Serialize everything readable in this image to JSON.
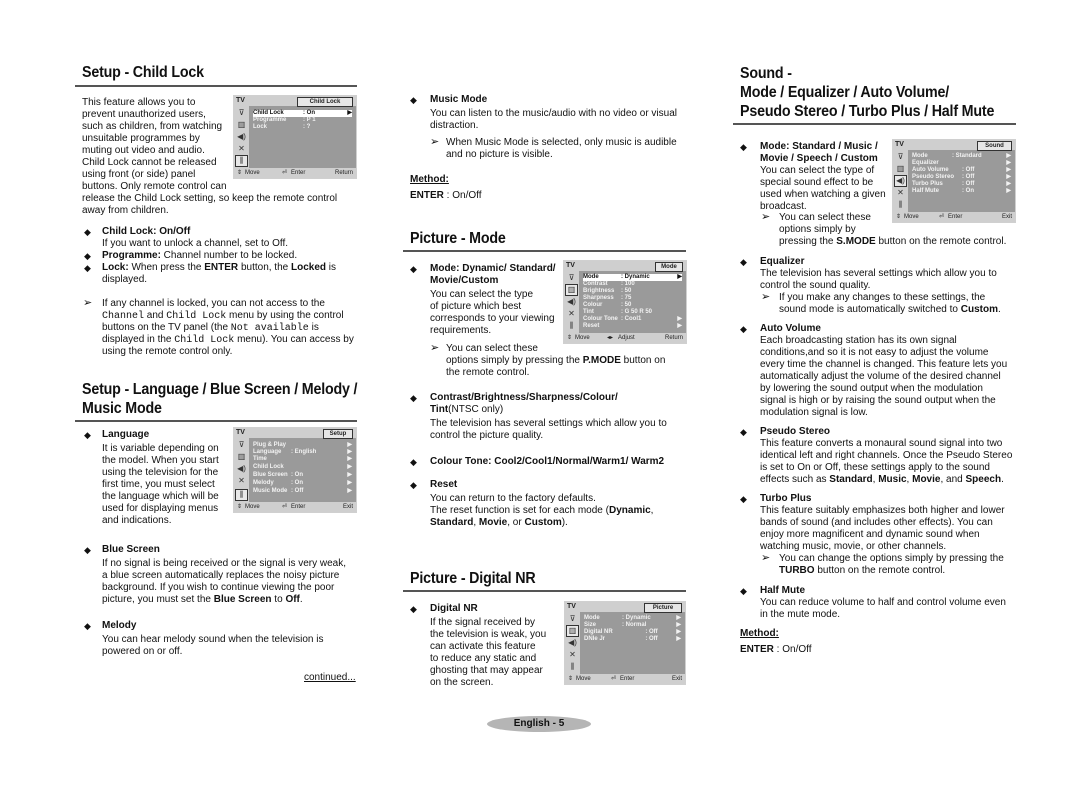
{
  "left": {
    "title1": "Setup - Child Lock",
    "intro": "This feature allows you to prevent unauthorized users, such as children, from watching unsuitable programmes by muting out video and audio. Child Lock cannot be released using front (or side) panel buttons. Only remote control can release the Child Lock setting, so keep the remote control away from children.",
    "intro_lines": [
      "This feature allows you to",
      "prevent unauthorized users,",
      "such as children, from watching",
      "unsuitable programmes by",
      "muting out video and audio.",
      "Child Lock cannot be released",
      "using front (or side) panel",
      "buttons. Only remote control can",
      "release the Child Lock setting, so keep the remote control",
      "away from children."
    ],
    "childlock_osd": {
      "tv": "TV",
      "tab": "Child Lock",
      "rows": [
        {
          "label": "Child Lock",
          "value": ": On",
          "arrow": "▶"
        },
        {
          "label": "Programme",
          "value": ": P 1",
          "arrow": ""
        },
        {
          "label": "Lock",
          "value": ": ?",
          "arrow": ""
        }
      ],
      "footer": {
        "move": "Move",
        "enter": "Enter",
        "exit": "Return"
      }
    },
    "b1_head": "Child Lock: On/Off",
    "b1_text": "If you want to unlock a channel, set to Off.",
    "b2_head": "Programme:",
    "b2_text": " Channel number to be locked.",
    "b3_head": "Lock:",
    "b3_t1": " When press the ",
    "b3_enter": "ENTER",
    "b3_t2": " button, the ",
    "b3_locked": "Locked",
    "b3_t3": " is",
    "b3_t4": "displayed.",
    "note1": "If any channel is locked, you can not access to the",
    "note2a": "Channel",
    "note2b": " and ",
    "note2c": "Child Lock",
    "note2d": " menu by using the control",
    "note3a": "buttons on the TV panel (the ",
    "note3b": "Not available",
    "note3c": " is",
    "note4a": "displayed in the ",
    "note4b": "Child Lock",
    "note4c": " menu). You can access by",
    "note5": "using the remote control only.",
    "title2_l1": "Setup - Language / Blue Screen / Melody /",
    "title2_l2": "Music Mode",
    "lang_head": "Language",
    "lang_lines": [
      "It is variable depending on",
      "the model. When you start",
      "using the television for the",
      "first time, you must select",
      "the language which will be",
      "used for displaying menus",
      "and indications."
    ],
    "setup_osd": {
      "tv": "TV",
      "tab": "Setup",
      "rows": [
        {
          "label": "Plug & Play",
          "value": "",
          "arrow": "▶"
        },
        {
          "label": "Language",
          "value": ": English",
          "arrow": "▶"
        },
        {
          "label": "Time",
          "value": "",
          "arrow": "▶"
        },
        {
          "label": "Child Lock",
          "value": "",
          "arrow": "▶"
        },
        {
          "label": "Blue Screen",
          "value": ": On",
          "arrow": "▶"
        },
        {
          "label": "Melody",
          "value": ": On",
          "arrow": "▶"
        },
        {
          "label": "Music Mode",
          "value": ": Off",
          "arrow": "▶"
        }
      ],
      "footer": {
        "move": "Move",
        "enter": "Enter",
        "exit": "Exit"
      }
    },
    "blue_head": "Blue Screen",
    "blue_lines": [
      "If no signal is being received or the signal is very weak,",
      "a blue screen automatically replaces the noisy picture",
      "background. If you wish to continue viewing the poor"
    ],
    "blue_l4a": "picture, you must set the ",
    "blue_l4b": "Blue Screen",
    "blue_l4c": " to ",
    "blue_l4d": "Off",
    "blue_l4e": ".",
    "melody_head": "Melody",
    "melody_lines": [
      "You can hear melody sound when the television is",
      "powered on or off."
    ],
    "continued": "continued..."
  },
  "middle": {
    "music_head": "Music Mode",
    "music_lines": [
      "You can listen to the music/audio with no video or visual",
      "distraction."
    ],
    "music_note": [
      "When Music Mode is selected, only music is audible",
      "and no picture is visible."
    ],
    "method_label": "Method:",
    "method_enter": "ENTER",
    "method_value": " : On/Off",
    "title_picture_mode": "Picture - Mode",
    "mode_head_l1": "Mode: Dynamic/ Standard/",
    "mode_head_l2": "Movie/Custom",
    "mode_lines": [
      "You can select the type",
      "of picture which best",
      "corresponds to your viewing",
      "requirements."
    ],
    "mode_note_l1": "You can select these",
    "mode_note_l2a": "options simply by pressing the ",
    "mode_note_l2b": "P.MODE",
    "mode_note_l2c": " button on",
    "mode_note_l3": "the remote control.",
    "mode_osd": {
      "tv": "TV",
      "tab": "Mode",
      "rows": [
        {
          "label": "Mode",
          "value": ": Dynamic",
          "arrow": "▶"
        },
        {
          "label": "Contrast",
          "value": ":          100",
          "arrow": ""
        },
        {
          "label": "Brightness",
          "value": ":            50",
          "arrow": ""
        },
        {
          "label": "Sharpness",
          "value": ":            75",
          "arrow": ""
        },
        {
          "label": "Colour",
          "value": ":            50",
          "arrow": ""
        },
        {
          "label": "Tint",
          "value": ": G  50    R  50",
          "arrow": ""
        },
        {
          "label": "Colour Tone",
          "value": ": Cool1",
          "arrow": "▶"
        },
        {
          "label": "Reset",
          "value": "",
          "arrow": "▶"
        }
      ],
      "footer": {
        "move": "Move",
        "enter": "Adjust",
        "exit": "Return"
      }
    },
    "cbs_head_l1": "Contrast/Brightness/Sharpness/Colour/",
    "cbs_head_l2a": "Tint",
    "cbs_head_l2b": "(NTSC only)",
    "cbs_lines": [
      "The television has several settings which allow you to",
      "control the picture quality."
    ],
    "tone_head": "Colour Tone: Cool2/Cool1/Normal/Warm1/ Warm2",
    "reset_head": "Reset",
    "reset_l1": "You can return to the factory defaults.",
    "reset_l2a": "The reset function is set for each mode (",
    "reset_l2b": "Dynamic",
    "reset_l2c": ",",
    "reset_l3a": "Standard",
    "reset_l3b": ", ",
    "reset_l3c": "Movie",
    "reset_l3d": ", or ",
    "reset_l3e": "Custom",
    "reset_l3f": ").",
    "title_digital_nr": "Picture - Digital NR",
    "dnr_head": "Digital NR",
    "dnr_lines": [
      "If the signal received by",
      "the television is weak, you",
      "can activate this feature",
      "to reduce any static and",
      "ghosting that may appear",
      "on the screen."
    ],
    "picture_osd": {
      "tv": "TV",
      "tab": "Picture",
      "rows": [
        {
          "label": "Mode",
          "value": ": Dynamic",
          "arrow": "▶"
        },
        {
          "label": "Size",
          "value": ": Normal",
          "arrow": "▶"
        },
        {
          "label": "Digital NR",
          "value": "              : Off",
          "arrow": "▶"
        },
        {
          "label": "DNIe Jr",
          "value": "              : Off",
          "arrow": "▶"
        }
      ],
      "footer": {
        "move": "Move",
        "enter": "Enter",
        "exit": "Exit"
      }
    }
  },
  "right": {
    "title_l1": "Sound -",
    "title_l2": "Mode / Equalizer / Auto Volume/",
    "title_l3": "Pseudo Stereo / Turbo Plus / Half Mute",
    "mode_head_l1": "Mode: Standard / Music /",
    "mode_head_l2": "Movie / Speech / Custom",
    "mode_lines": [
      "You can select the type of",
      "special sound effect to be",
      "used when watching a given",
      "broadcast."
    ],
    "mode_note_l1": "You can select these",
    "mode_note_l2": "options simply by",
    "mode_note_l3a": "pressing the ",
    "mode_note_l3b": "S.MODE",
    "mode_note_l3c": " button on the remote control.",
    "sound_osd": {
      "tv": "TV",
      "tab": "Sound",
      "rows": [
        {
          "label": "Mode",
          "value": ": Standard",
          "arrow": "▶"
        },
        {
          "label": "Equalizer",
          "value": "",
          "arrow": "▶"
        },
        {
          "label": "Auto Volume",
          "value": "      : Off",
          "arrow": "▶"
        },
        {
          "label": "Pseudo Stereo",
          "value": "      : Off",
          "arrow": "▶"
        },
        {
          "label": "Turbo Plus",
          "value": "      : Off",
          "arrow": "▶"
        },
        {
          "label": "Half Mute",
          "value": "      : On",
          "arrow": "▶"
        }
      ],
      "footer": {
        "move": "Move",
        "enter": "Enter",
        "exit": "Exit"
      }
    },
    "eq_head": "Equalizer",
    "eq_lines": [
      "The television has several settings which allow you to",
      "control the sound quality."
    ],
    "eq_note_l1": "If you make any changes to these settings, the",
    "eq_note_l2a": "sound mode is automatically switched to ",
    "eq_note_l2b": "Custom",
    "eq_note_l2c": ".",
    "av_head": "Auto Volume",
    "av_lines": [
      "Each broadcasting station has its own signal",
      "conditions,and so it is not easy to adjust the volume",
      "every time the channel is changed. This feature lets you",
      "automatically adjust the volume of the desired channel",
      "by lowering the sound output when the modulation",
      "signal is high or by raising the sound output when the",
      "modulation signal is low."
    ],
    "ps_head": "Pseudo Stereo",
    "ps_lines": [
      "This feature converts a monaural sound signal into two",
      "identical left and right channels. Once the Pseudo Stereo",
      "is set to On or Off, these settings apply to the sound"
    ],
    "ps_l4a": "effects such as ",
    "ps_l4b": "Standard",
    "ps_l4c": ", ",
    "ps_l4d": "Music",
    "ps_l4e": ", ",
    "ps_l4f": "Movie",
    "ps_l4g": ", and ",
    "ps_l4h": "Speech",
    "ps_l4i": ".",
    "tp_head": "Turbo Plus",
    "tp_lines": [
      "This feature suitably emphasizes both higher and lower",
      "bands of sound (and includes other effects). You can",
      "enjoy more magnificent and dynamic sound when",
      "watching music, movie, or other channels."
    ],
    "tp_note_l1": "You can change the options simply by pressing the",
    "tp_note_l2a": "TURBO",
    "tp_note_l2b": " button on the remote control.",
    "hm_head": "Half Mute",
    "hm_lines": [
      "You can reduce volume to half and control volume even",
      "in the mute mode."
    ],
    "method_label": "Method:",
    "method_enter": "ENTER",
    "method_value": " : On/Off"
  },
  "footer": {
    "page": "English - 5"
  },
  "icons": {
    "bullet": "◆",
    "note": "➢",
    "osd_arrow": "▶"
  }
}
